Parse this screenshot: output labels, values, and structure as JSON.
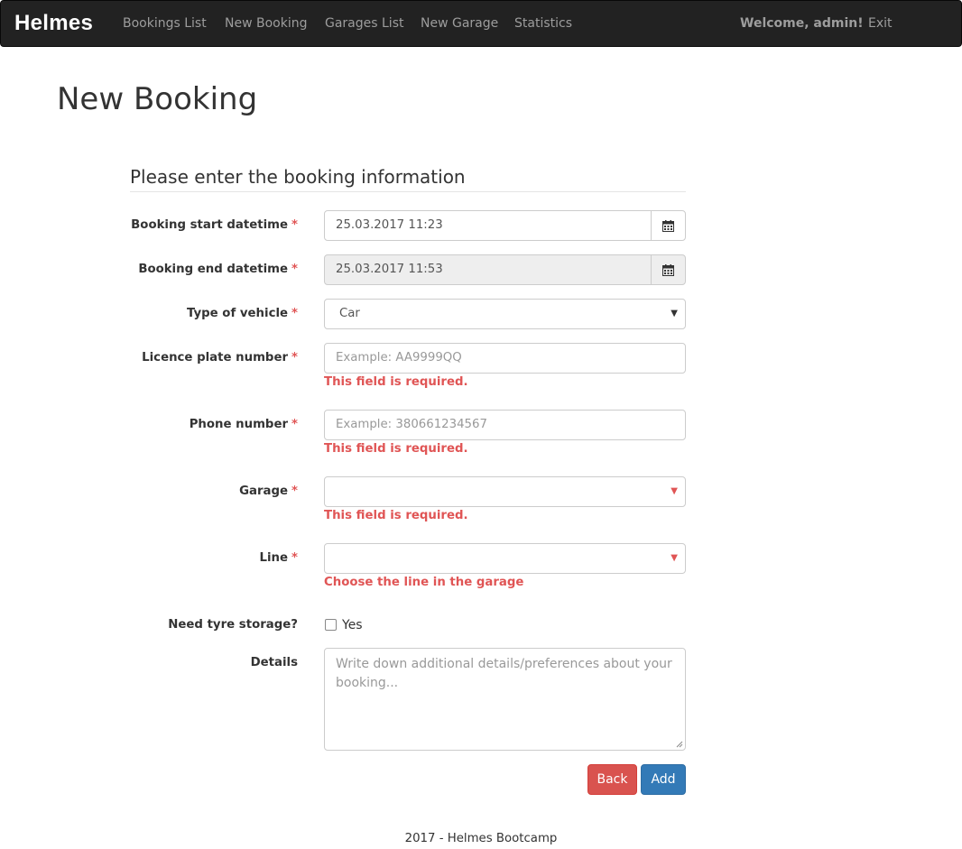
{
  "navbar": {
    "brand": "Helmes",
    "links": [
      "Bookings List",
      "New Booking",
      "Garages List",
      "New Garage",
      "Statistics"
    ],
    "welcome": "Welcome, admin!",
    "exit": "Exit"
  },
  "page": {
    "title": "New Booking",
    "section_title": "Please enter the booking information"
  },
  "form": {
    "required_mark": "*",
    "start": {
      "label": "Booking start datetime",
      "value": "25.03.2017 11:23",
      "icon": "calendar-icon"
    },
    "end": {
      "label": "Booking end datetime",
      "value": "25.03.2017 11:53",
      "icon": "calendar-icon"
    },
    "vehicle": {
      "label": "Type of vehicle",
      "value": "Car"
    },
    "plate": {
      "label": "Licence plate number",
      "placeholder": "Example: AA9999QQ",
      "error": "This field is required."
    },
    "phone": {
      "label": "Phone number",
      "placeholder": "Example: 380661234567",
      "error": "This field is required."
    },
    "garage": {
      "label": "Garage",
      "value": "",
      "error": "This field is required."
    },
    "line": {
      "label": "Line",
      "value": "",
      "error": "Choose the line in the garage"
    },
    "tyre": {
      "label": "Need tyre storage?",
      "option": "Yes",
      "checked": false
    },
    "details": {
      "label": "Details",
      "placeholder": "Write down additional details/preferences about your booking..."
    }
  },
  "buttons": {
    "back": "Back",
    "add": "Add"
  },
  "footer": "2017 - Helmes Bootcamp",
  "colors": {
    "navbar": "#222222",
    "error": "#e05555",
    "back": "#d9534f",
    "add": "#337ab7"
  }
}
